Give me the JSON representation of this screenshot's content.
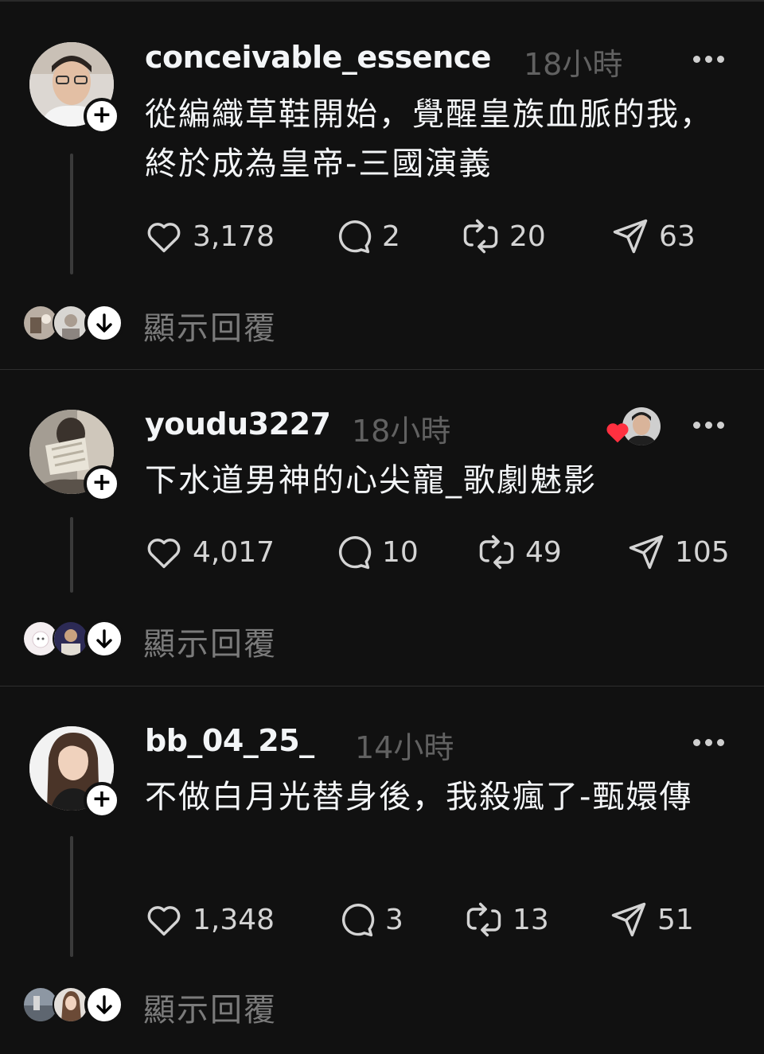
{
  "posts": [
    {
      "username": "conceivable_essence",
      "time": "18小時",
      "text": "從編織草鞋開始，覺醒皇族血脈的我，終於成為皇帝-三國演義",
      "likes": "3,178",
      "comments": "2",
      "reposts": "20",
      "shares": "63",
      "show_replies": "顯示回覆"
    },
    {
      "username": "youdu3227",
      "time": "18小時",
      "text": "下水道男神的心尖寵_歌劇魅影",
      "likes": "4,017",
      "comments": "10",
      "reposts": "49",
      "shares": "105",
      "show_replies": "顯示回覆"
    },
    {
      "username": "bb_04_25_",
      "time": "14小時",
      "text": "不做白月光替身後，我殺瘋了-甄嬛傳",
      "likes": "1,348",
      "comments": "3",
      "reposts": "13",
      "shares": "51",
      "show_replies": "顯示回覆"
    }
  ],
  "icons": {
    "like": "heart-icon",
    "comment": "comment-bubble-icon",
    "repost": "repost-icon",
    "share": "send-icon",
    "follow": "plus-icon",
    "expand": "arrow-down-icon",
    "more": "more-dots-icon",
    "liked_by": "red-heart-icon"
  },
  "colors": {
    "background": "#111111",
    "text": "#f3f5f7",
    "muted": "#616161",
    "liked_heart": "#ff3040"
  }
}
